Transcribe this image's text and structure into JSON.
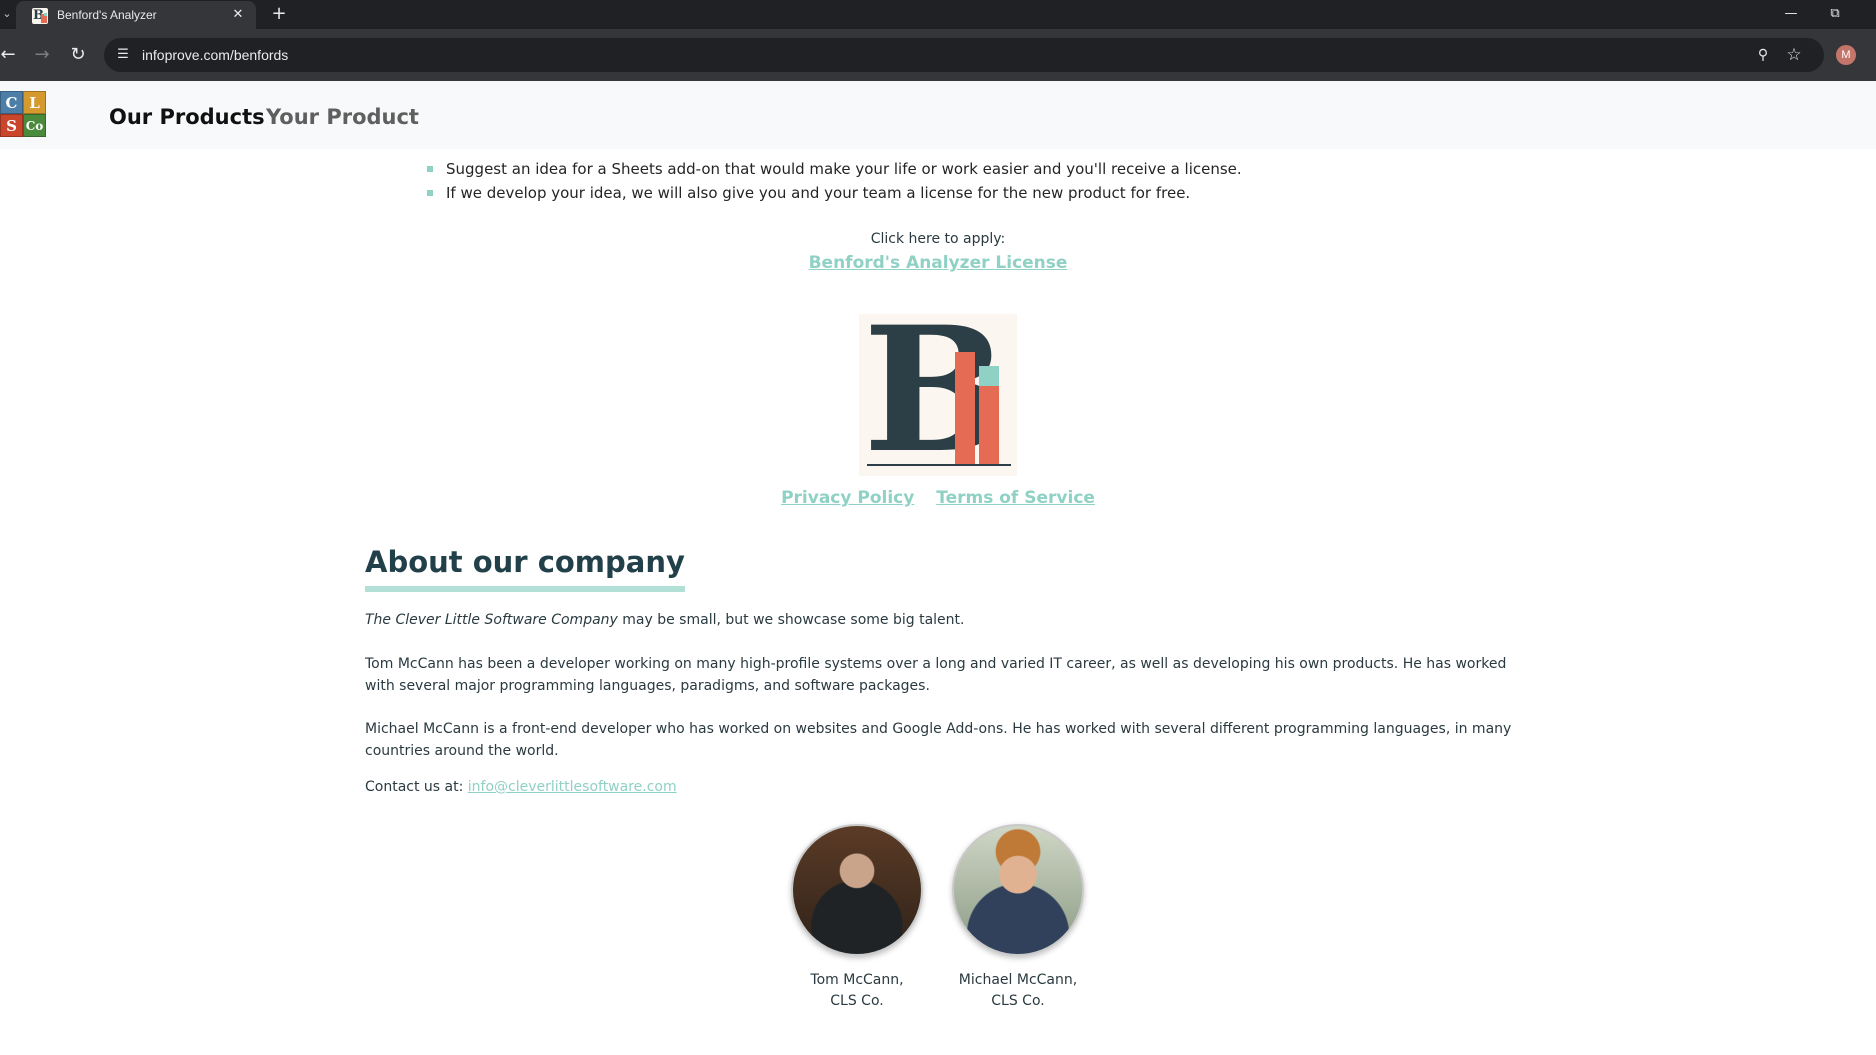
{
  "browser": {
    "tab_title": "Benford's Analyzer",
    "url": "infoprove.com/benfords",
    "profile_initial": "M",
    "icons": {
      "tab_list": "chevron-down",
      "tab_close": "close",
      "new_tab": "plus",
      "back": "arrow-left",
      "forward": "arrow-right",
      "reload": "reload",
      "site_info": "tune",
      "zoom": "magnifier",
      "bookmark": "star",
      "minimize": "minimize",
      "restore": "restore"
    }
  },
  "header": {
    "logo_tiles": [
      "C",
      "L",
      "S",
      "Co"
    ],
    "logo_colors": [
      "#4d7ea8",
      "#d49a2e",
      "#c9462c",
      "#4a8a3c"
    ],
    "nav": [
      "Our Products",
      "Your Product"
    ]
  },
  "main": {
    "bullets": [
      "Suggest an idea for a Sheets add-on that would make your life or work easier and you'll receive a license.",
      "If we develop your idea, we will also give you and your team a license for the new product for free."
    ],
    "apply_label": "Click here to apply:",
    "apply_link": "Benford's Analyzer License",
    "product_logo_letter": "B",
    "legal_links": [
      "Privacy Policy",
      "Terms of Service"
    ]
  },
  "about": {
    "heading": "About our company",
    "intro_company": "The Clever Little Software Company",
    "intro_rest": " may be small, but we showcase some big talent.",
    "tom_bio": "Tom McCann has been a developer working on many high-profile systems over a long and varied IT career, as well as developing his own products. He has worked with several major programming languages, paradigms, and software packages.",
    "michael_bio": "Michael McCann is a front-end developer who has worked on websites and Google Add-ons. He has worked with several different programming languages, in many countries around the world.",
    "contact_label": "Contact us at: ",
    "contact_email": "info@cleverlittlesoftware.com",
    "people": [
      {
        "name": "Tom McCann,",
        "org": "CLS Co."
      },
      {
        "name": "Michael McCann,",
        "org": "CLS Co."
      }
    ]
  },
  "colors": {
    "accent": "#8fd1c4",
    "heading": "#22404a",
    "brand_dark": "#2c3e46",
    "brand_red": "#e56b55"
  }
}
